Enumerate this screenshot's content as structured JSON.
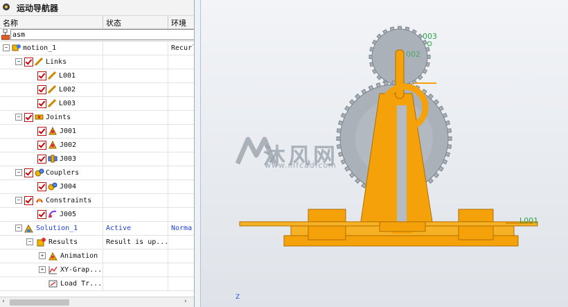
{
  "navigator": {
    "title": "运动导航器",
    "columns": {
      "name": "名称",
      "status": "状态",
      "env": "环境"
    },
    "search_value": "asm",
    "tree": [
      {
        "label": "motion_1",
        "status": "",
        "env": "Recurl"
      },
      {
        "label": "Links",
        "status": "",
        "env": ""
      },
      {
        "label": "L001",
        "status": "",
        "env": ""
      },
      {
        "label": "L002",
        "status": "",
        "env": ""
      },
      {
        "label": "L003",
        "status": "",
        "env": ""
      },
      {
        "label": "Joints",
        "status": "",
        "env": ""
      },
      {
        "label": "J001",
        "status": "",
        "env": ""
      },
      {
        "label": "J002",
        "status": "",
        "env": ""
      },
      {
        "label": "J003",
        "status": "",
        "env": ""
      },
      {
        "label": "Couplers",
        "status": "",
        "env": ""
      },
      {
        "label": "J004",
        "status": "",
        "env": ""
      },
      {
        "label": "Constraints",
        "status": "",
        "env": ""
      },
      {
        "label": "J005",
        "status": "",
        "env": ""
      },
      {
        "label": "Solution_1",
        "status": "Active",
        "env": "Norma"
      },
      {
        "label": "Results",
        "status": "Result is up...",
        "env": ""
      },
      {
        "label": "Animation",
        "status": "",
        "env": ""
      },
      {
        "label": "XY-Grap...",
        "status": "",
        "env": ""
      },
      {
        "label": "Load Tr...",
        "status": "",
        "env": ""
      }
    ]
  },
  "viewport": {
    "watermark_cn": "沐风网",
    "watermark_url": "www.mfcad.com",
    "label_003": "003",
    "label_002": "002",
    "label_l001": "L001",
    "triad_label": "Z"
  },
  "colors": {
    "gear_gray": "#aab1b9",
    "part_orange": "#f5a20a",
    "label_green": "#2aa34a",
    "status_blue": "#1a3fd0"
  }
}
